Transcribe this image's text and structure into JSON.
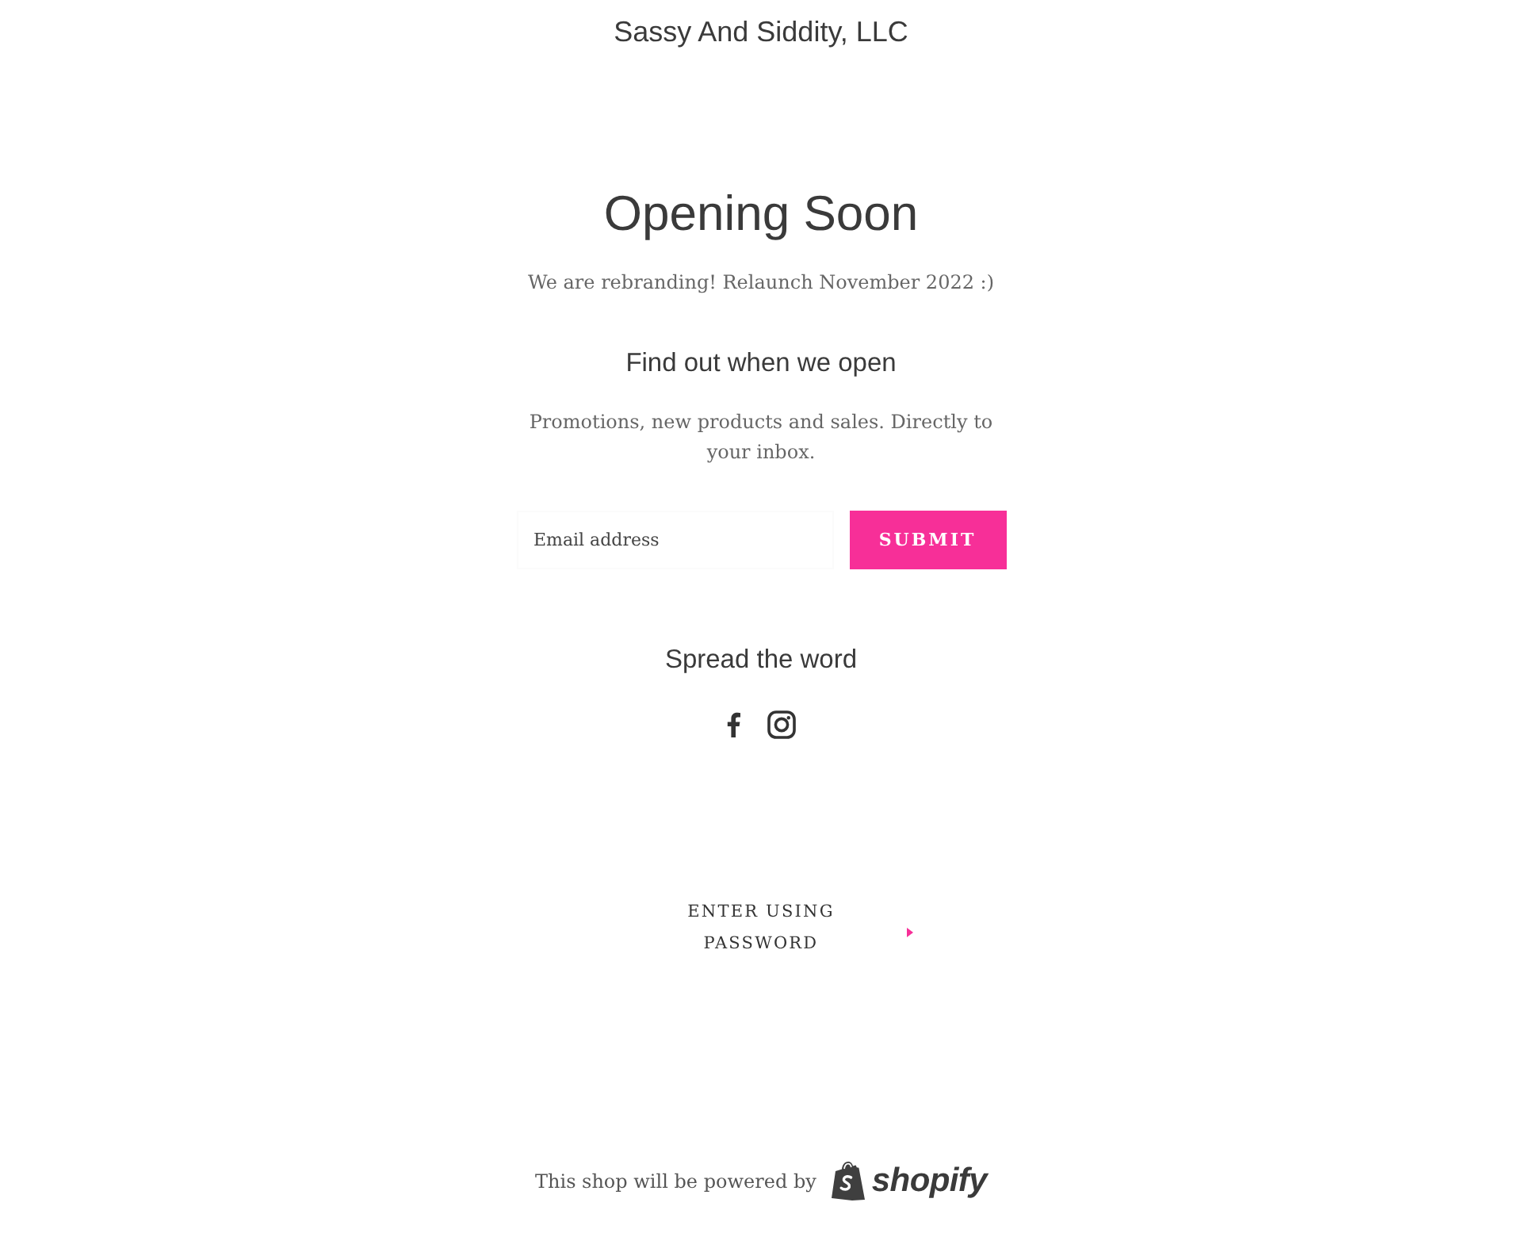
{
  "header": {
    "shop_name": "Sassy And Siddity, LLC"
  },
  "main": {
    "title": "Opening Soon",
    "message": "We are rebranding! Relaunch November 2022 :)"
  },
  "signup": {
    "heading": "Find out when we open",
    "text": "Promotions, new products and sales. Directly to your inbox.",
    "email": {
      "placeholder": "Email address"
    },
    "button": "SUBMIT"
  },
  "social": {
    "heading": "Spread the word",
    "links": [
      {
        "kind": "facebook"
      },
      {
        "kind": "instagram"
      }
    ]
  },
  "password_link": {
    "label": "ENTER USING PASSWORD"
  },
  "footer": {
    "text": "This shop will be powered by",
    "logo_text": "shopify"
  }
}
